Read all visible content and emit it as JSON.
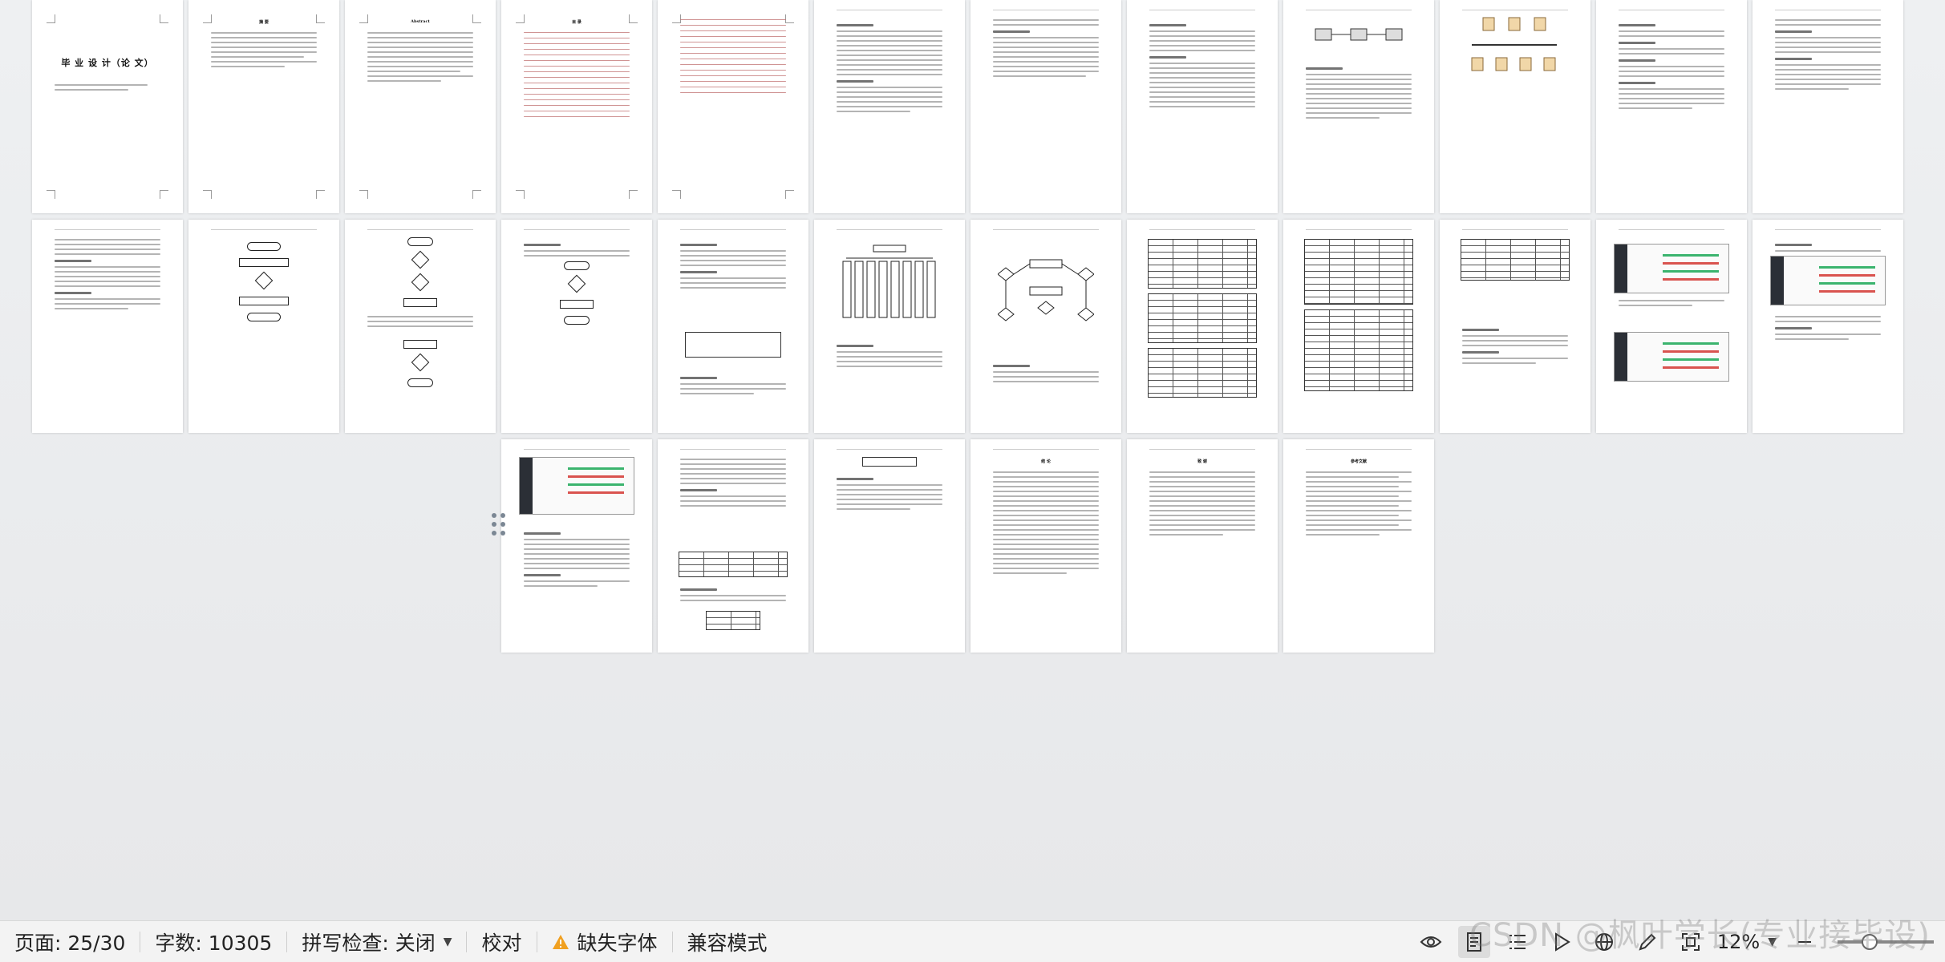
{
  "document": {
    "cover_title": "毕 业 设 计（论 文）",
    "abstract_cn_title": "摘 要",
    "abstract_en_title": "Abstract",
    "toc_title": "目 录",
    "conclusion_title": "结 论",
    "thanks_title": "致 谢",
    "references_title": "参考文献"
  },
  "statusbar": {
    "page_indicator": "页面: 25/30",
    "word_count": "字数: 10305",
    "spellcheck": "拼写检查: 关闭",
    "proofread": "校对",
    "missing_fonts": "缺失字体",
    "compat_mode": "兼容模式",
    "zoom": "12%"
  },
  "watermark": "CSDN @枫叶学长(专业接毕设)",
  "colors": {
    "accent_warning": "#f0a020",
    "statusbar_bg": "#f3f3f3",
    "canvas_bg": "#e9eaec"
  },
  "icons": [
    "eye-icon",
    "page-view-icon",
    "outline-icon",
    "play-icon",
    "globe-icon",
    "pen-icon",
    "fit-icon"
  ]
}
